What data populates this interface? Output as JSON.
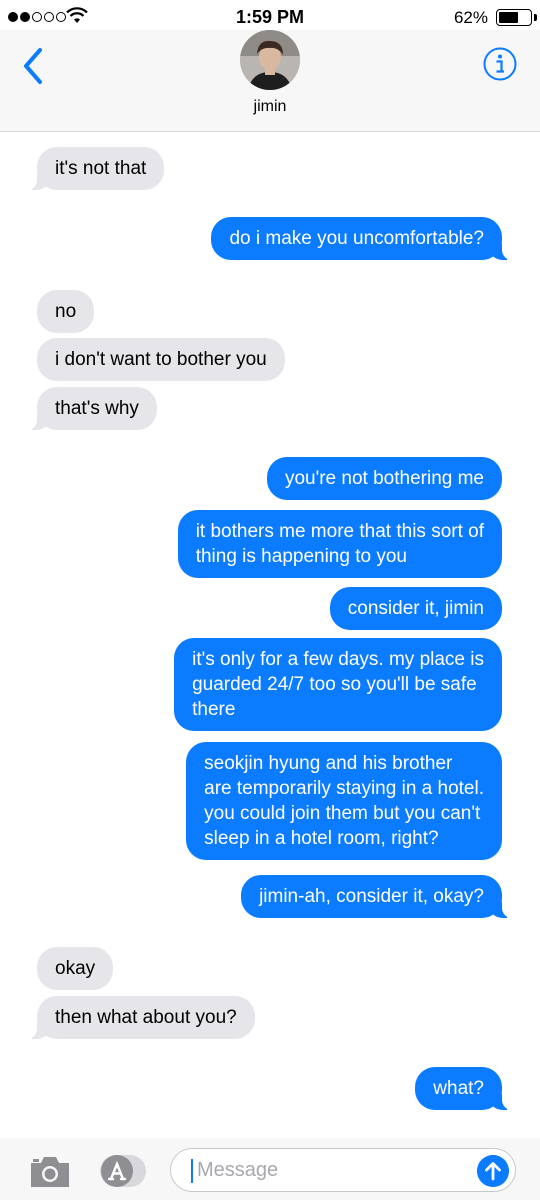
{
  "status_bar": {
    "signal_bars": 2,
    "signal_total": 5,
    "wifi": "wifi-icon",
    "time": "1:59 PM",
    "battery_percent": "62%",
    "battery_level": 0.62
  },
  "header": {
    "back_icon": "chevron-left-icon",
    "contact_name": "jimin",
    "info_icon": "info-icon",
    "colors": {
      "accent": "#0b7bff",
      "header_bg": "#f7f7f8"
    }
  },
  "messages": [
    {
      "direction": "incoming",
      "text": "it's not that"
    },
    {
      "direction": "outgoing",
      "text": "do i make you uncomfortable?"
    },
    {
      "direction": "incoming",
      "text": "no"
    },
    {
      "direction": "incoming",
      "text": "i don't want to bother you"
    },
    {
      "direction": "incoming",
      "text": "that's why"
    },
    {
      "direction": "outgoing",
      "text": "you're not bothering me"
    },
    {
      "direction": "outgoing",
      "lines": [
        "it bothers me more that this sort of",
        "thing is happening to you"
      ]
    },
    {
      "direction": "outgoing",
      "text": "consider it, jimin"
    },
    {
      "direction": "outgoing",
      "lines": [
        "it's only for a few days. my place is",
        "guarded 24/7 too so you'll be safe",
        "there"
      ]
    },
    {
      "direction": "outgoing",
      "lines": [
        "seokjin hyung and his brother",
        "are temporarily staying in a hotel.",
        "you could join them but you can't",
        "sleep in a hotel room, right?"
      ]
    },
    {
      "direction": "outgoing",
      "text": "jimin-ah, consider it, okay?"
    },
    {
      "direction": "incoming",
      "text": "okay"
    },
    {
      "direction": "incoming",
      "text": "then what about you?"
    },
    {
      "direction": "outgoing",
      "text": "what?"
    }
  ],
  "input_bar": {
    "camera_icon": "camera-icon",
    "apps_icon": "app-store-icon",
    "placeholder": "Message",
    "send_icon": "arrow-up-icon",
    "colors": {
      "incoming_bubble": "#e5e5ea",
      "outgoing_bubble": "#0b7bff"
    }
  }
}
